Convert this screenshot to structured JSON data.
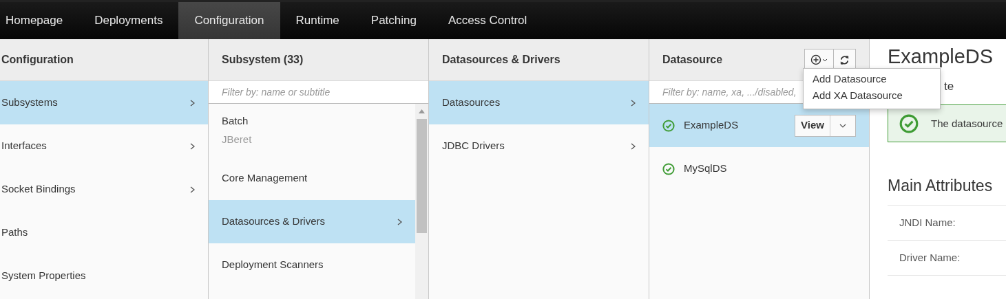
{
  "nav": {
    "tabs": [
      {
        "label": "Homepage",
        "selected": false
      },
      {
        "label": "Deployments",
        "selected": false
      },
      {
        "label": "Configuration",
        "selected": true
      },
      {
        "label": "Runtime",
        "selected": false
      },
      {
        "label": "Patching",
        "selected": false
      },
      {
        "label": "Access Control",
        "selected": false
      }
    ]
  },
  "columns": [
    {
      "title": "Configuration",
      "items": [
        {
          "label": "Subsystems",
          "has_children": true,
          "selected": true
        },
        {
          "label": "Interfaces",
          "has_children": true,
          "selected": false
        },
        {
          "label": "Socket Bindings",
          "has_children": true,
          "selected": false
        },
        {
          "label": "Paths",
          "has_children": false,
          "selected": false
        },
        {
          "label": "System Properties",
          "has_children": false,
          "selected": false
        }
      ]
    },
    {
      "title": "Subsystem (33)",
      "filter": {
        "placeholder": "Filter by: name or subtitle"
      },
      "scrollbar": true,
      "items": [
        {
          "label": "Batch",
          "subtitle": "JBeret",
          "has_children": false,
          "selected": false
        },
        {
          "label": "Core Management",
          "has_children": false,
          "selected": false
        },
        {
          "label": "Datasources & Drivers",
          "has_children": true,
          "selected": true
        },
        {
          "label": "Deployment Scanners",
          "has_children": false,
          "selected": false
        }
      ]
    },
    {
      "title": "Datasources & Drivers",
      "items": [
        {
          "label": "Datasources",
          "has_children": true,
          "selected": true
        },
        {
          "label": "JDBC Drivers",
          "has_children": true,
          "selected": false
        }
      ]
    },
    {
      "title": "Datasource",
      "filter": {
        "placeholder": "Filter by: name, xa, .../disabled,"
      },
      "tools": {
        "add_menu": {
          "expanded": true,
          "items": [
            "Add Datasource",
            "Add XA Datasource"
          ]
        }
      },
      "items": [
        {
          "label": "ExampleDS",
          "ok": true,
          "has_children": false,
          "selected": true,
          "action": "View"
        },
        {
          "label": "MySqlDS",
          "ok": true,
          "has_children": false,
          "selected": false
        }
      ]
    }
  ],
  "details": {
    "title": "ExampleDS",
    "subtitle": "te",
    "alert": {
      "kind": "success",
      "text": "The datasource"
    },
    "section_title": "Main Attributes",
    "attributes": [
      {
        "label": "JNDI Name:"
      },
      {
        "label": "Driver Name:"
      }
    ]
  }
}
